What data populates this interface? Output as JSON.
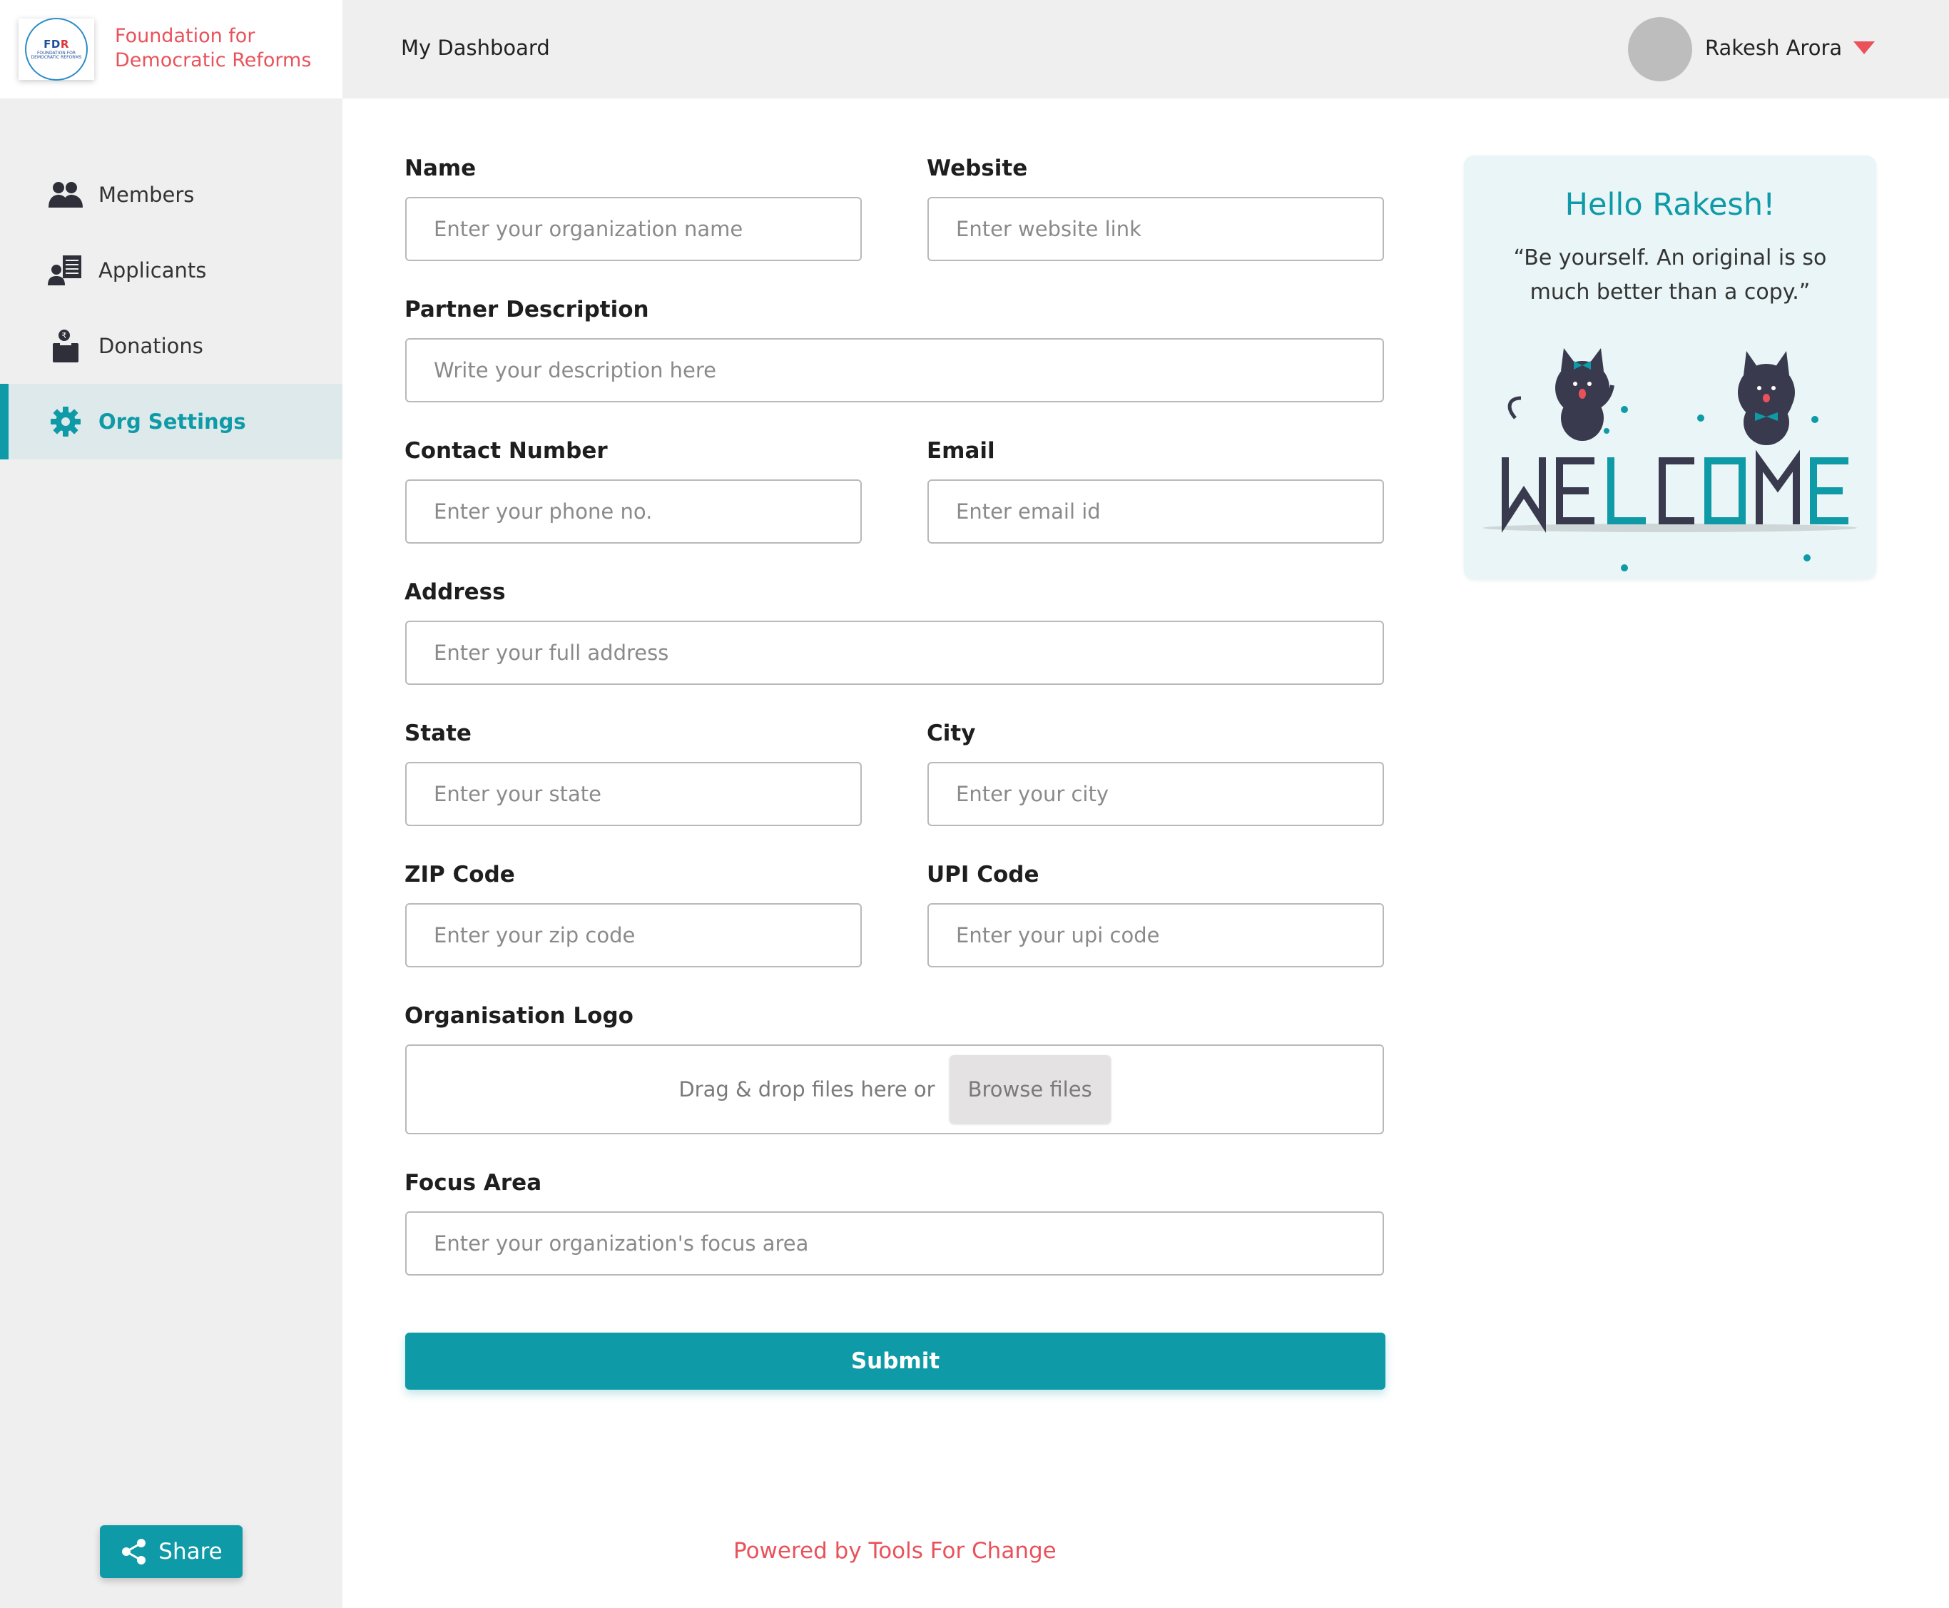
{
  "brand": {
    "logo_abbrev_fd": "FD",
    "logo_abbrev_r": "R",
    "logo_caption": "FOUNDATION FOR DEMOCRATIC REFORMS",
    "name_line1": "Foundation for",
    "name_line2": "Democratic Reforms",
    "accent": "#0e9aa7",
    "brand_red": "#e9525b"
  },
  "header": {
    "title": "My Dashboard",
    "user_name": "Rakesh Arora"
  },
  "sidebar": {
    "items": [
      {
        "label": "Members",
        "icon": "members-icon",
        "active": false
      },
      {
        "label": "Applicants",
        "icon": "applicants-icon",
        "active": false
      },
      {
        "label": "Donations",
        "icon": "donations-icon",
        "active": false
      },
      {
        "label": "Org Settings",
        "icon": "gear-icon",
        "active": true
      }
    ],
    "share_label": "Share"
  },
  "form": {
    "name": {
      "label": "Name",
      "placeholder": "Enter your organization name"
    },
    "website": {
      "label": "Website",
      "placeholder": "Enter website link"
    },
    "description": {
      "label": "Partner Description",
      "placeholder": "Write your description here"
    },
    "contact": {
      "label": "Contact Number",
      "placeholder": "Enter your phone no."
    },
    "email": {
      "label": "Email",
      "placeholder": "Enter email id"
    },
    "address": {
      "label": "Address",
      "placeholder": "Enter your full address"
    },
    "state": {
      "label": "State",
      "placeholder": "Enter your state"
    },
    "city": {
      "label": "City",
      "placeholder": "Enter your city"
    },
    "zip": {
      "label": "ZIP Code",
      "placeholder": "Enter your zip code"
    },
    "upi": {
      "label": "UPI Code",
      "placeholder": "Enter your upi code"
    },
    "logo": {
      "label": "Organisation Logo",
      "drop_text": "Drag & drop files here or",
      "browse_label": "Browse files"
    },
    "focus": {
      "label": "Focus Area",
      "placeholder": "Enter your organization's focus area"
    },
    "submit_label": "Submit"
  },
  "welcome": {
    "greeting": "Hello Rakesh!",
    "quote": "“Be yourself. An original is so much better than a copy.”",
    "art_text": "WELCOME"
  },
  "footer": {
    "powered_by": "Powered by Tools For Change"
  }
}
